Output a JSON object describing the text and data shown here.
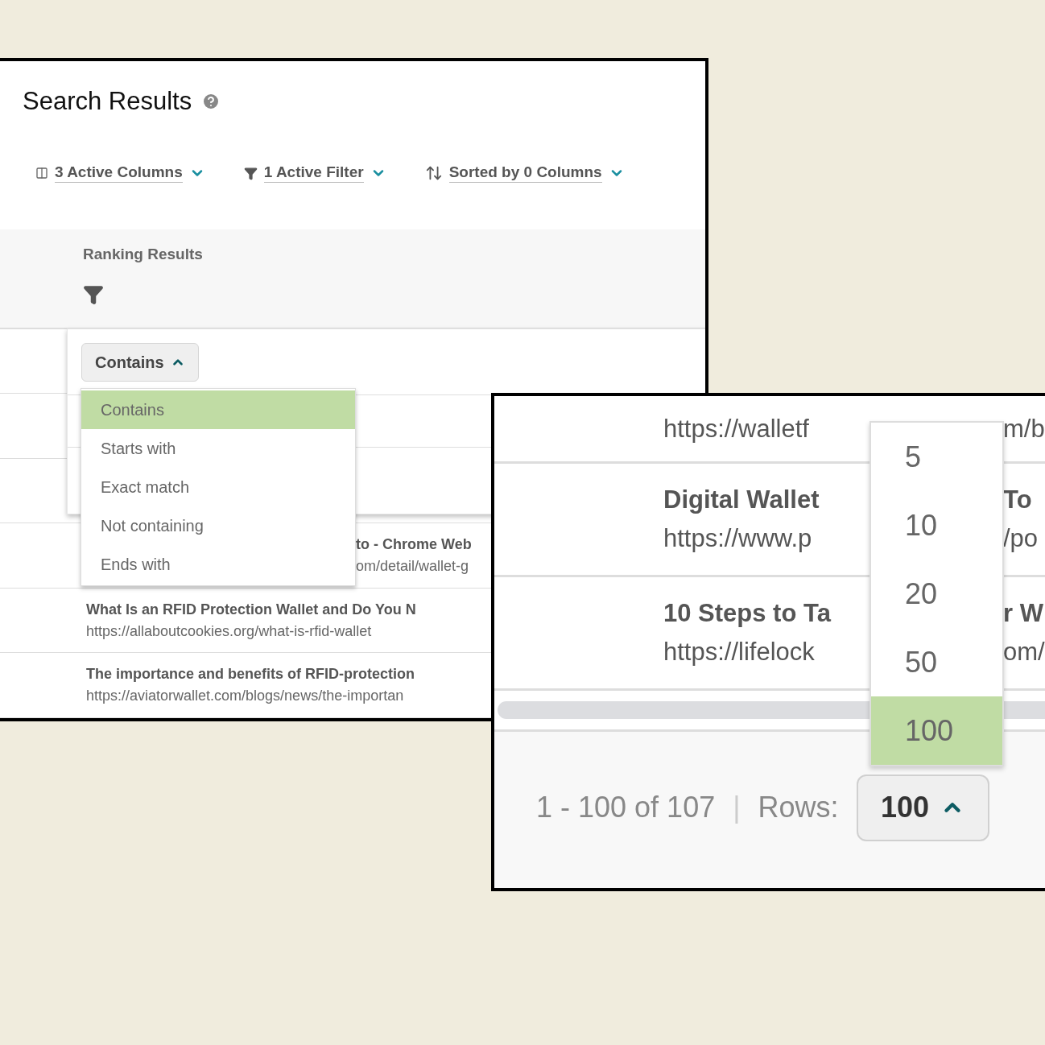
{
  "results_panel": {
    "title": "Search Results",
    "toolbar": [
      {
        "kind": "columns",
        "label": "3 Active Columns"
      },
      {
        "kind": "filter",
        "label": "1 Active Filter"
      },
      {
        "kind": "sort",
        "label": "Sorted by 0 Columns"
      }
    ],
    "column_header": "Ranking Results",
    "filter_popover": {
      "match_button": "Contains",
      "options": [
        {
          "label": "Contains",
          "selected": true
        },
        {
          "label": "Starts with",
          "selected": false
        },
        {
          "label": "Exact match",
          "selected": false
        },
        {
          "label": "Not containing",
          "selected": false
        },
        {
          "label": "Ends with",
          "selected": false
        }
      ]
    },
    "rows": [
      {
        "kind": "covered",
        "title": "to - Chrome Web",
        "url": "om/detail/wallet-g"
      },
      {
        "kind": "full",
        "title": "What Is an RFID Protection Wallet and Do You N",
        "url": "https://allaboutcookies.org/what-is-rfid-wallet"
      },
      {
        "kind": "full",
        "title": "The importance and benefits of RFID-protection",
        "url": "https://aviatorwallet.com/blogs/news/the-importan"
      }
    ]
  },
  "pagination_panel": {
    "rows": [
      {
        "url_start": "https://walletf",
        "url_end": "m/b"
      },
      {
        "title_start": "Digital Wallet",
        "title_end": "To",
        "url_start": "https://www.p",
        "url_end": "/po"
      },
      {
        "title_start": "10 Steps to Ta",
        "title_end": "r W",
        "url_start": "https://lifelock",
        "url_end": "om/"
      }
    ],
    "range": "1 - 100 of 107",
    "separator": "|",
    "rows_label": "Rows:",
    "rows_button": "100",
    "row_options": [
      {
        "label": "5",
        "selected": false
      },
      {
        "label": "10",
        "selected": false
      },
      {
        "label": "20",
        "selected": false
      },
      {
        "label": "50",
        "selected": false
      },
      {
        "label": "100",
        "selected": true
      }
    ]
  }
}
